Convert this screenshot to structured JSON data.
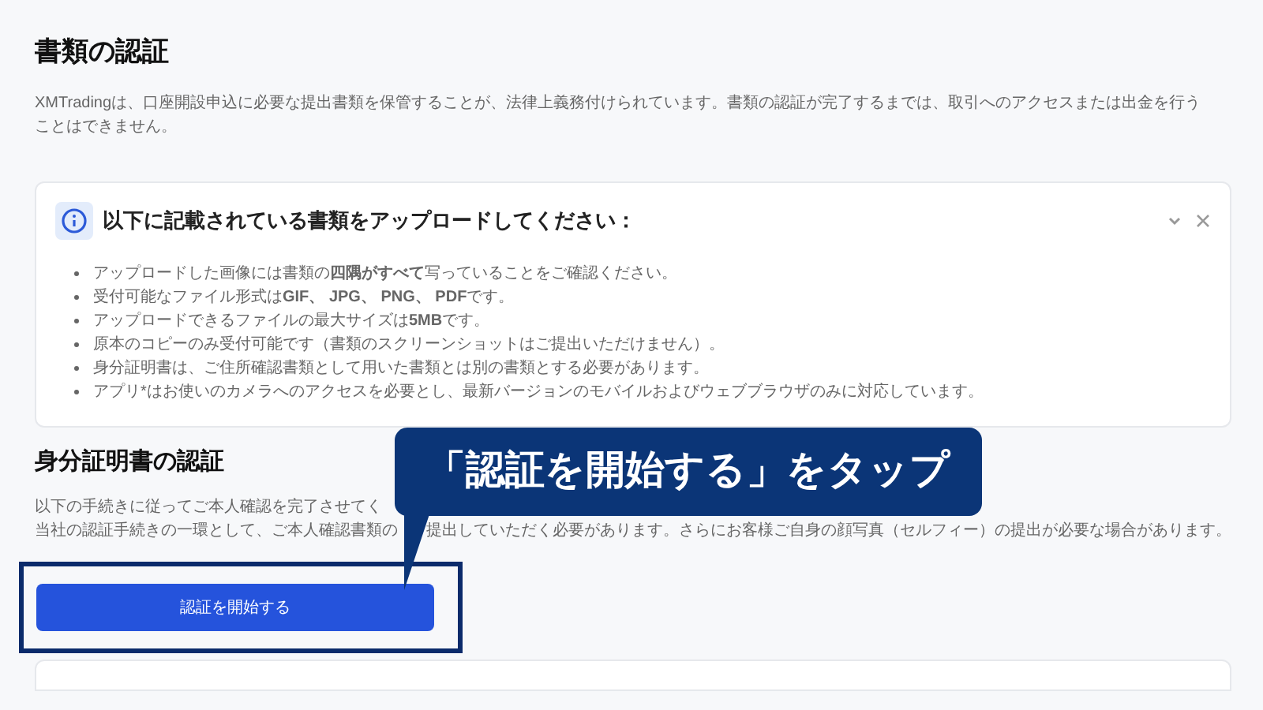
{
  "documents": {
    "title": "書類の認証",
    "description": "XMTradingは、口座開設申込に必要な提出書類を保管することが、法律上義務付けられています。書類の認証が完了するまでは、取引へのアクセスまたは出金を行うことはできません。"
  },
  "notice": {
    "title": "以下に記載されている書類をアップロードしてください：",
    "expanded": true,
    "items": [
      "アップロードした画像には書類の**四隅がすべて**写っていることをご確認ください。",
      "受付可能なファイル形式は**GIF、 JPG、 PNG、 PDF**です。",
      "アップロードできるファイルの最大サイズは**5MB**です。",
      "原本のコピーのみ受付可能です（書類のスクリーンショットはご提出いただけません）。",
      "身分証明書は、ご住所確認書類として用いた書類とは別の書類とする必要があります。",
      "アプリ*はお使いのカメラへのアクセスを必要とし、最新バージョンのモバイルおよびウェブブラウザのみに対応しています。"
    ]
  },
  "identity": {
    "title": "身分証明書の認証",
    "line_1": "以下の手続きに従ってご本人確認を完了させてく",
    "line_2_start": "当社の認証手続きの一環として、ご本人確認書類の",
    "line_2_end": "提出していただく必要があります。さらにお客様ご自身の顔写真（セルフィー）の提出が必要な場合があります。",
    "button": "認証を開始する"
  },
  "callout": {
    "text": "「認証を開始する」をタップ"
  }
}
